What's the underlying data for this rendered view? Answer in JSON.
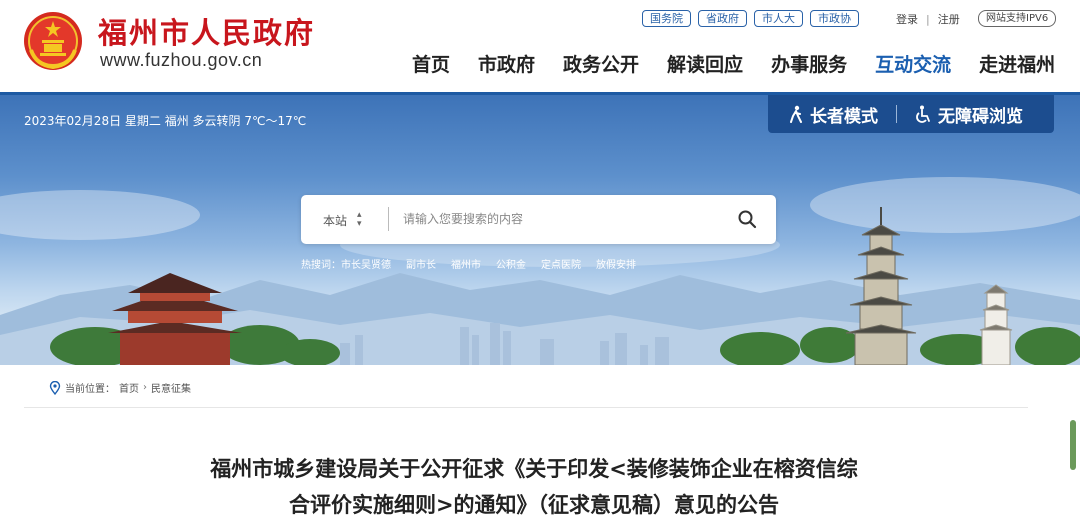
{
  "header": {
    "title": "福州市人民政府",
    "url": "www.fuzhou.gov.cn",
    "top_links": [
      "国务院",
      "省政府",
      "市人大",
      "市政协"
    ],
    "login": "登录",
    "register": "注册",
    "separator": "|",
    "ipv6": "网站支持IPV6",
    "nav": [
      "首页",
      "市政府",
      "政务公开",
      "解读回应",
      "办事服务",
      "互动交流",
      "走进福州"
    ],
    "active_nav": "互动交流",
    "accent_color": "#1b5fb0",
    "title_color": "#c8161d"
  },
  "banner": {
    "date_weather": "2023年02月28日 星期二 福州 多云转阴 7℃～17℃",
    "senior_mode": "长者模式",
    "accessible": "无障碍浏览"
  },
  "search": {
    "scope": "本站",
    "placeholder": "请输入您要搜索的内容",
    "hot_label": "热搜词：",
    "hot_words": [
      "市长吴贤德",
      "副市长",
      "福州市",
      "公积金",
      "定点医院",
      "放假安排"
    ]
  },
  "breadcrumb": {
    "label": "当前位置：",
    "items": [
      "首页",
      "民意征集"
    ],
    "separator": "›"
  },
  "article": {
    "title_line1": "福州市城乡建设局关于公开征求《关于印发<装修装饰企业在榕资信综",
    "title_line2": "合评价实施细则>的通知》（征求意见稿）意见的公告"
  }
}
